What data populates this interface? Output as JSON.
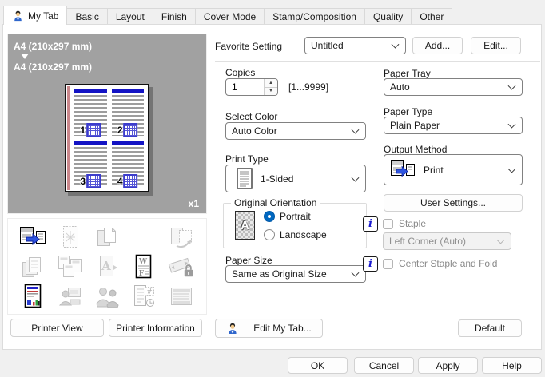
{
  "tabs": [
    {
      "label": "My Tab",
      "active": true
    },
    {
      "label": "Basic"
    },
    {
      "label": "Layout"
    },
    {
      "label": "Finish"
    },
    {
      "label": "Cover Mode"
    },
    {
      "label": "Stamp/Composition"
    },
    {
      "label": "Quality"
    },
    {
      "label": "Other"
    }
  ],
  "preview": {
    "source": "A4 (210x297 mm)",
    "target": "A4 (210x297 mm)",
    "zoom": "x1",
    "pages": [
      "1",
      "2",
      "3",
      "4"
    ]
  },
  "status_icons": [
    {
      "name": "print-output-icon",
      "active": true
    },
    {
      "name": "combination-page-icon",
      "active": false
    },
    {
      "name": "duplex-pages-icon",
      "active": false
    },
    {
      "name": "rotate-output-icon",
      "active": false
    },
    {
      "name": "collate-pages-icon",
      "active": false
    },
    {
      "name": "layout-pages-icon",
      "active": false
    },
    {
      "name": "watermark-icon",
      "active": false
    },
    {
      "name": "overlay-icon",
      "active": true
    },
    {
      "name": "secure-print-icon",
      "active": false
    },
    {
      "name": "color-settings-icon",
      "active": true
    },
    {
      "name": "user-authentication-icon",
      "active": false
    },
    {
      "name": "account-track-icon",
      "active": false
    },
    {
      "name": "job-schedule-icon",
      "active": false
    },
    {
      "name": "banner-page-icon",
      "active": false
    }
  ],
  "left_buttons": {
    "printer_view": "Printer View",
    "printer_information": "Printer Information"
  },
  "favorite": {
    "label": "Favorite Setting",
    "value": "Untitled",
    "add_label": "Add...",
    "edit_label": "Edit..."
  },
  "copies": {
    "label": "Copies",
    "value": "1",
    "range": "[1...9999]"
  },
  "select_color": {
    "label": "Select Color",
    "value": "Auto Color"
  },
  "print_type": {
    "label": "Print Type",
    "value": "1-Sided"
  },
  "orientation": {
    "label": "Original Orientation",
    "portrait": "Portrait",
    "landscape": "Landscape",
    "selected": "Portrait"
  },
  "paper_size": {
    "label": "Paper Size",
    "value": "Same as Original Size"
  },
  "paper_tray": {
    "label": "Paper Tray",
    "value": "Auto"
  },
  "paper_type": {
    "label": "Paper Type",
    "value": "Plain Paper"
  },
  "output_method": {
    "label": "Output Method",
    "value": "Print"
  },
  "user_settings_label": "User Settings...",
  "staple": {
    "label": "Staple",
    "checked": false,
    "position_value": "Left Corner (Auto)",
    "enabled": false
  },
  "center_staple": {
    "label": "Center Staple and Fold",
    "checked": false,
    "enabled": false
  },
  "edit_my_tab_label": "Edit My Tab...",
  "default_label": "Default",
  "footer": {
    "ok": "OK",
    "cancel": "Cancel",
    "apply": "Apply",
    "help": "Help"
  },
  "icons": {
    "info_glyph": "i",
    "orientation_letter": "A"
  },
  "colors": {
    "accent_blue": "#0067c0",
    "preview_bg": "#a1a1a1",
    "page_header_blue": "#1313c4",
    "binding_edge_pink": "#c9878b",
    "info_icon_blue": "#1818cf",
    "dialog_bg": "#f0f0f0"
  }
}
